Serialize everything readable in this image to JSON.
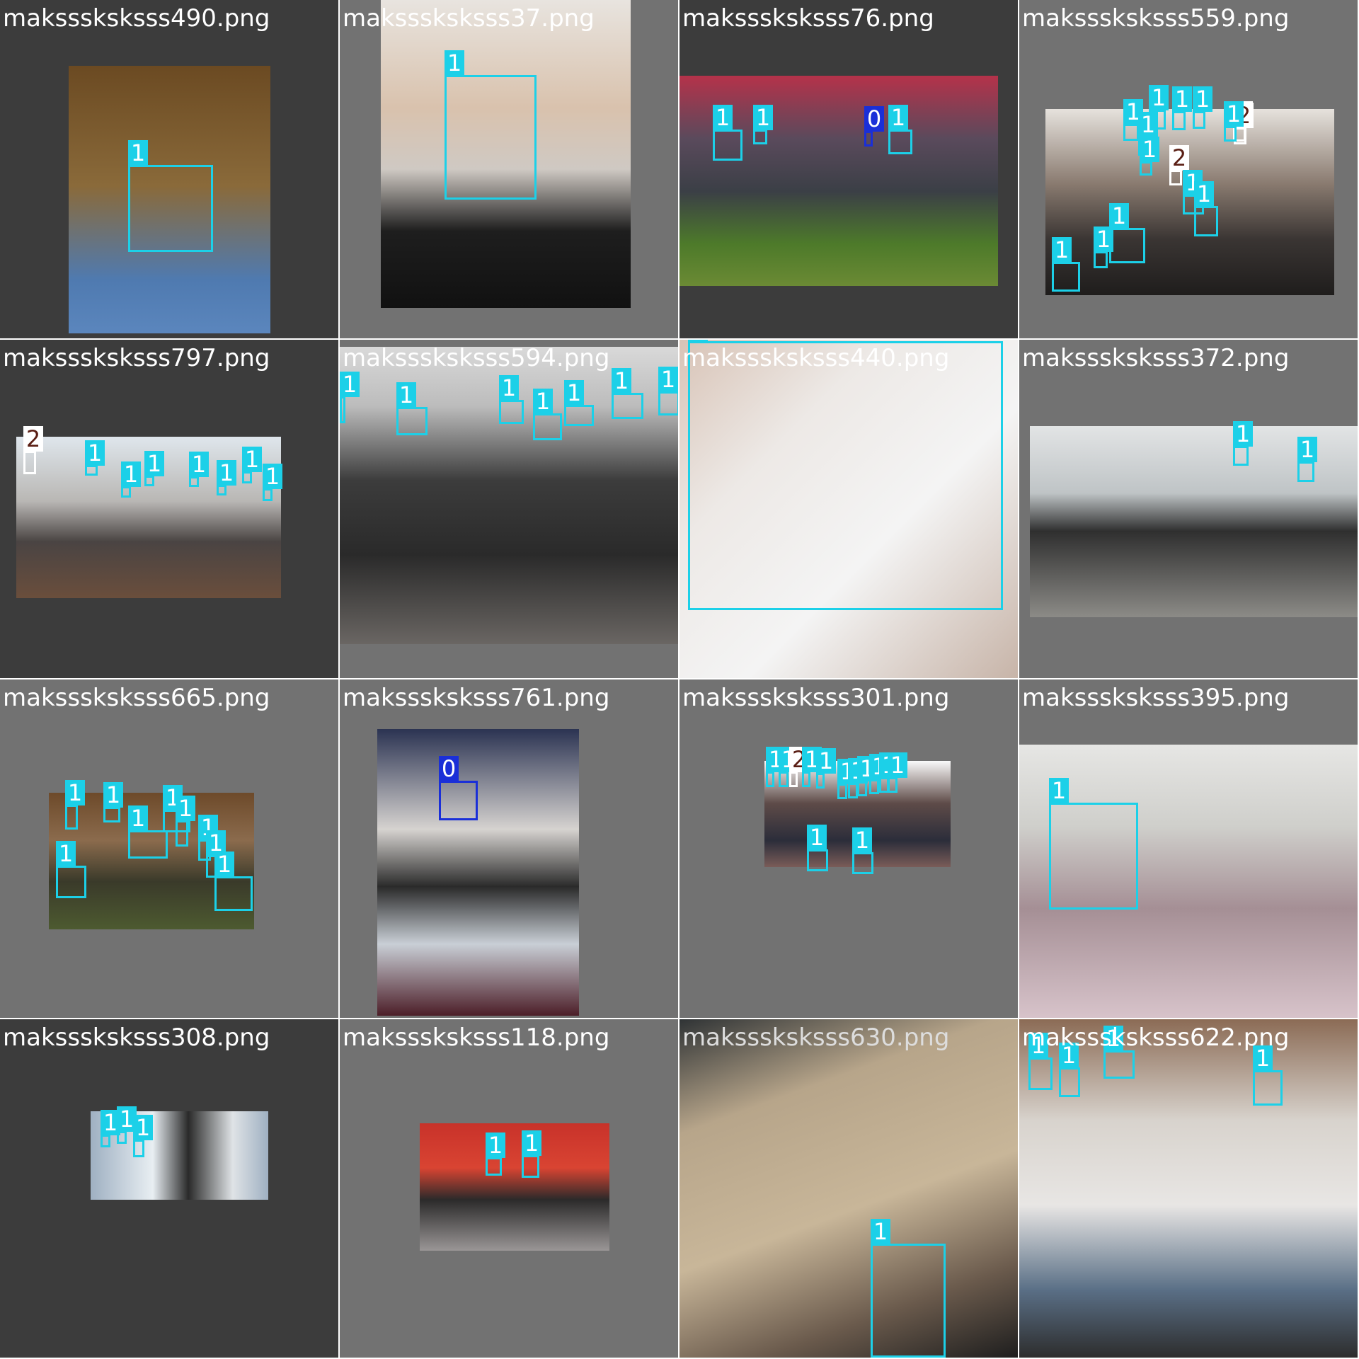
{
  "mosaic": {
    "tiles": [
      {
        "filename": "maksssksksss490.png",
        "label_color": "#ffffff",
        "tile_bg": "#3c3c3c",
        "photo_bg": "linear-gradient(180deg,#6b4a22 0%,#8a6a3a 45%,#4f7ab0 80%,#5b86bd 100%)",
        "boxes": [
          {
            "cls": "1"
          }
        ]
      },
      {
        "filename": "maksssksksss37.png",
        "label_color": "#ffffff",
        "tile_bg": "#727272",
        "photo_bg": "linear-gradient(180deg,#e8e4df 0%,#d9c2ad 35%,#cfc9c3 55%,#1e1e1e 75%,#111111 100%)",
        "boxes": [
          {
            "cls": "1"
          }
        ]
      },
      {
        "filename": "maksssksksss76.png",
        "label_color": "#ffffff",
        "tile_bg": "#3c3c3c",
        "photo_bg": "linear-gradient(180deg,#b5324a 0%,#5a4a5c 30%,#3b3f46 55%,#4d7a2a 80%,#6b8a34 100%)",
        "boxes": [
          {
            "cls": "1"
          },
          {
            "cls": "1"
          },
          {
            "cls": "0"
          },
          {
            "cls": "1"
          }
        ]
      },
      {
        "filename": "maksssksksss559.png",
        "label_color": "#ffffff",
        "tile_bg": "#727272",
        "photo_bg": "linear-gradient(180deg,#e6e2dd 0%,#8a7b70 40%,#3a3533 70%,#1f1d1c 100%)",
        "boxes": [
          {
            "cls": "1"
          },
          {
            "cls": "1"
          },
          {
            "cls": "1"
          },
          {
            "cls": "1"
          },
          {
            "cls": "1"
          },
          {
            "cls": "2"
          },
          {
            "cls": "1"
          },
          {
            "cls": "2"
          },
          {
            "cls": "1"
          },
          {
            "cls": "2"
          },
          {
            "cls": "1"
          },
          {
            "cls": "1"
          },
          {
            "cls": "1"
          },
          {
            "cls": "1"
          },
          {
            "cls": "1"
          }
        ]
      },
      {
        "filename": "maksssksksss797.png",
        "label_color": "#ffffff",
        "tile_bg": "#3c3c3c",
        "photo_bg": "linear-gradient(180deg,#dfe6ec 0%,#b9b7b4 40%,#4a4443 65%,#6a4e3c 100%)",
        "boxes": [
          {
            "cls": "2"
          },
          {
            "cls": "1"
          },
          {
            "cls": "1"
          },
          {
            "cls": "1"
          },
          {
            "cls": "1"
          },
          {
            "cls": "1"
          },
          {
            "cls": "1"
          },
          {
            "cls": "1"
          }
        ]
      },
      {
        "filename": "maksssksksss594.png",
        "label_color": "#ffffff",
        "tile_bg": "#727272",
        "photo_bg": "linear-gradient(180deg,#d9d9d9 0%,#bcbcbc 20%,#3c3c3c 45%,#2a2a2a 70%,#6a6663 100%)",
        "boxes": [
          {
            "cls": "1"
          },
          {
            "cls": "1"
          },
          {
            "cls": "1"
          },
          {
            "cls": "1"
          },
          {
            "cls": "1"
          },
          {
            "cls": "1"
          },
          {
            "cls": "1"
          },
          {
            "cls": "1"
          }
        ]
      },
      {
        "filename": "maksssksksss440.png",
        "label_color": "#ffffff",
        "tile_bg": "#ffffff",
        "photo_bg": "linear-gradient(135deg,#d8c3b6 0%,#ede9e6 30%,#f4f4f4 60%,#c7b4a8 100%)",
        "boxes": [
          {
            "cls": "1"
          }
        ]
      },
      {
        "filename": "maksssksksss372.png",
        "label_color": "#ffffff",
        "tile_bg": "#727272",
        "photo_bg": "linear-gradient(180deg,#e2e4e5 0%,#bfc4c6 35%,#2f2f2f 55%,#8c8b87 100%)",
        "boxes": [
          {
            "cls": "1"
          },
          {
            "cls": "1"
          }
        ]
      },
      {
        "filename": "maksssksksss665.png",
        "label_color": "#ffffff",
        "tile_bg": "#727272",
        "photo_bg": "linear-gradient(180deg,#6d4a2a 0%,#8b6b4d 35%,#3a3a2a 65%,#4d5a30 100%)",
        "boxes": [
          {
            "cls": "1"
          },
          {
            "cls": "1"
          },
          {
            "cls": "1"
          },
          {
            "cls": "1"
          },
          {
            "cls": "1"
          },
          {
            "cls": "1"
          },
          {
            "cls": "1"
          },
          {
            "cls": "1"
          },
          {
            "cls": "1"
          }
        ]
      },
      {
        "filename": "maksssksksss761.png",
        "label_color": "#ffffff",
        "tile_bg": "#727272",
        "photo_bg": "linear-gradient(180deg,#2b3352 0%,#d6d3d0 35%,#2a2a2a 55%,#c9cfd6 75%,#4c1e28 100%)",
        "boxes": [
          {
            "cls": "0"
          }
        ]
      },
      {
        "filename": "maksssksksss301.png",
        "label_color": "#ffffff",
        "tile_bg": "#727272",
        "photo_bg": "linear-gradient(180deg,#fafafa 0%,#5e4b48 40%,#2b2d3a 75%,#7a5c58 100%)",
        "boxes": [
          {
            "cls": "1"
          },
          {
            "cls": "1"
          },
          {
            "cls": "2"
          },
          {
            "cls": "1"
          },
          {
            "cls": "1"
          },
          {
            "cls": "1"
          },
          {
            "cls": "1"
          },
          {
            "cls": "1"
          },
          {
            "cls": "1"
          },
          {
            "cls": "1"
          },
          {
            "cls": "1"
          },
          {
            "cls": "1"
          },
          {
            "cls": "1"
          }
        ]
      },
      {
        "filename": "maksssksksss395.png",
        "label_color": "#ffffff",
        "tile_bg": "#727272",
        "photo_bg": "linear-gradient(180deg,#e6e6e4 0%,#cfcfcb 30%,#a58f95 60%,#d7c3ca 100%)",
        "boxes": [
          {
            "cls": "1"
          }
        ]
      },
      {
        "filename": "maksssksksss308.png",
        "label_color": "#ffffff",
        "tile_bg": "#3c3c3c",
        "photo_bg": "linear-gradient(90deg,#9fb0c2 0%,#e8eef2 35%,#2a2a2a 55%,#dfe3e6 80%,#9fb0c2 100%)",
        "boxes": [
          {
            "cls": "1"
          },
          {
            "cls": "1"
          },
          {
            "cls": "1"
          }
        ]
      },
      {
        "filename": "maksssksksss118.png",
        "label_color": "#ffffff",
        "tile_bg": "#727272",
        "photo_bg": "linear-gradient(180deg,#c8322a 0%,#d94432 35%,#2b2a2a 60%,#9a9696 100%)",
        "boxes": [
          {
            "cls": "1"
          },
          {
            "cls": "1"
          }
        ]
      },
      {
        "filename": "maksssksksss630.png",
        "label_color": "#dddddd",
        "tile_bg": "#6f6455",
        "photo_bg": "linear-gradient(160deg,#2f3335 0%,#b7a58a 25%,#c8b699 55%,#6a5a4c 80%,#1e1e1e 100%)",
        "boxes": [
          {
            "cls": "1"
          }
        ]
      },
      {
        "filename": "maksssksksss622.png",
        "label_color": "#ffffff",
        "tile_bg": "#727272",
        "photo_bg": "linear-gradient(180deg,#8b6b55 0%,#d8d3cd 30%,#e8e6e4 55%,#5a6f86 80%,#2d2d2d 100%)",
        "boxes": [
          {
            "cls": "1"
          },
          {
            "cls": "1"
          },
          {
            "cls": "1"
          },
          {
            "cls": "1"
          }
        ]
      }
    ]
  }
}
